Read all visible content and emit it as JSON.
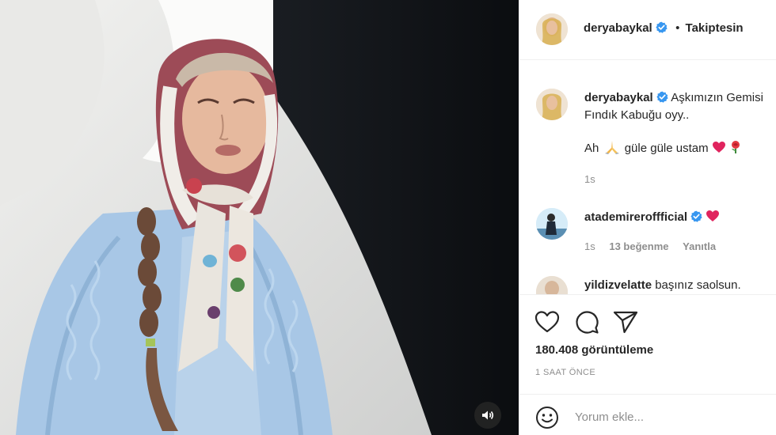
{
  "post": {
    "author": "deryabaykal",
    "verified": true,
    "separator": "•",
    "follow_status": "Takiptesin",
    "caption_line1": "Aşkımızın Gemisi",
    "caption_line2": "Fındık Kabuğu oyy..",
    "caption_line3_a": "Ah",
    "caption_line3_b": "güle güle ustam",
    "caption_time": "1s"
  },
  "comments": [
    {
      "user": "atademireroffficial",
      "verified": true,
      "text": "",
      "time": "1s",
      "likes": "13 beğenme",
      "reply": "Yanıtla"
    },
    {
      "user": "yildizvelatte",
      "verified": false,
      "text": "başınız saolsun."
    }
  ],
  "stats": {
    "views": "180.408 görüntüleme",
    "posted_ago": "1 SAAT ÖNCE"
  },
  "comment_box": {
    "placeholder": "Yorum ekle..."
  },
  "colors": {
    "verified_blue": "#3897f0",
    "heart_red": "#e0245e",
    "muted_text": "#8e8e8e",
    "divider": "#efefef"
  }
}
